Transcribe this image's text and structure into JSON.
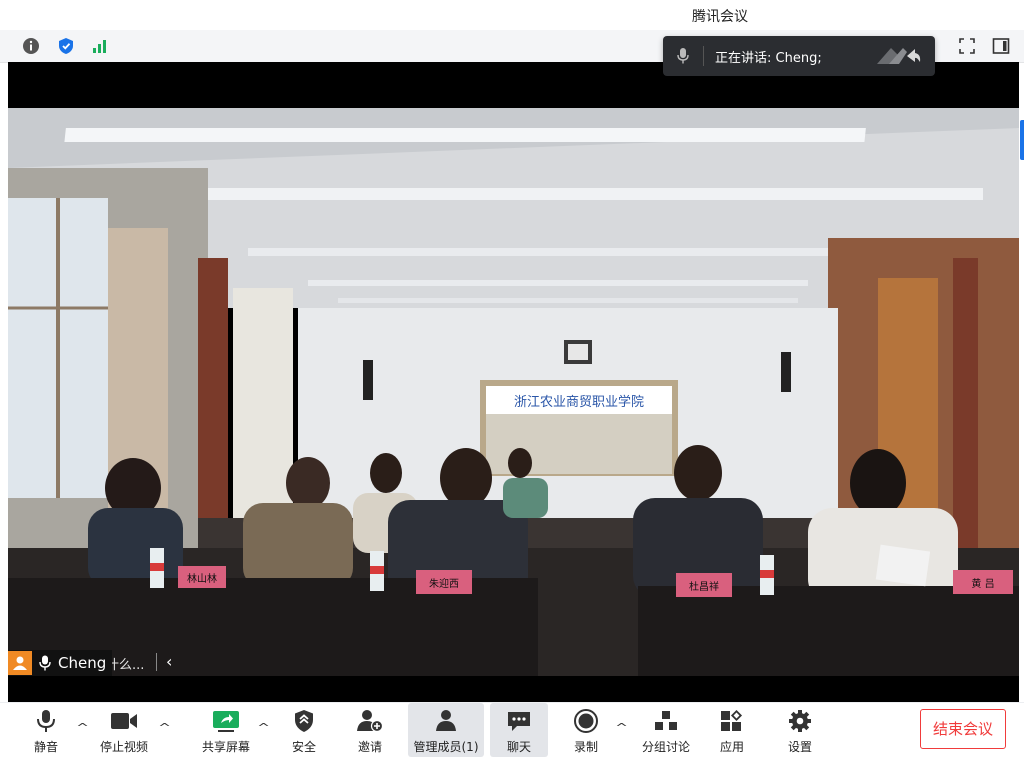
{
  "window": {
    "title": "腾讯会议"
  },
  "speaking_banner": {
    "prefix": "正在讲话: ",
    "speaker": "Cheng;"
  },
  "chat": {
    "placeholder": "说点什么...",
    "collapse_glyph": "‹"
  },
  "name_tag": {
    "name": "Cheng"
  },
  "toolbar": {
    "mute": "静音",
    "stop_video": "停止视频",
    "share_screen": "共享屏幕",
    "security": "安全",
    "invite": "邀请",
    "manage_members": "管理成员(1)",
    "chat": "聊天",
    "record": "录制",
    "breakout": "分组讨论",
    "apps": "应用",
    "settings": "设置",
    "end_meeting": "结束会议"
  },
  "room_scene": {
    "wall_banner": "浙江农业商贸职业学院",
    "nameplates": [
      "林山林",
      "朱迎西",
      "杜昌祥",
      "黄 吕"
    ]
  },
  "colors": {
    "accent_red": "#f03b3b",
    "share_green": "#1aad5c",
    "security_blue": "#1a73e8",
    "avatar_orange": "#f08a24"
  }
}
